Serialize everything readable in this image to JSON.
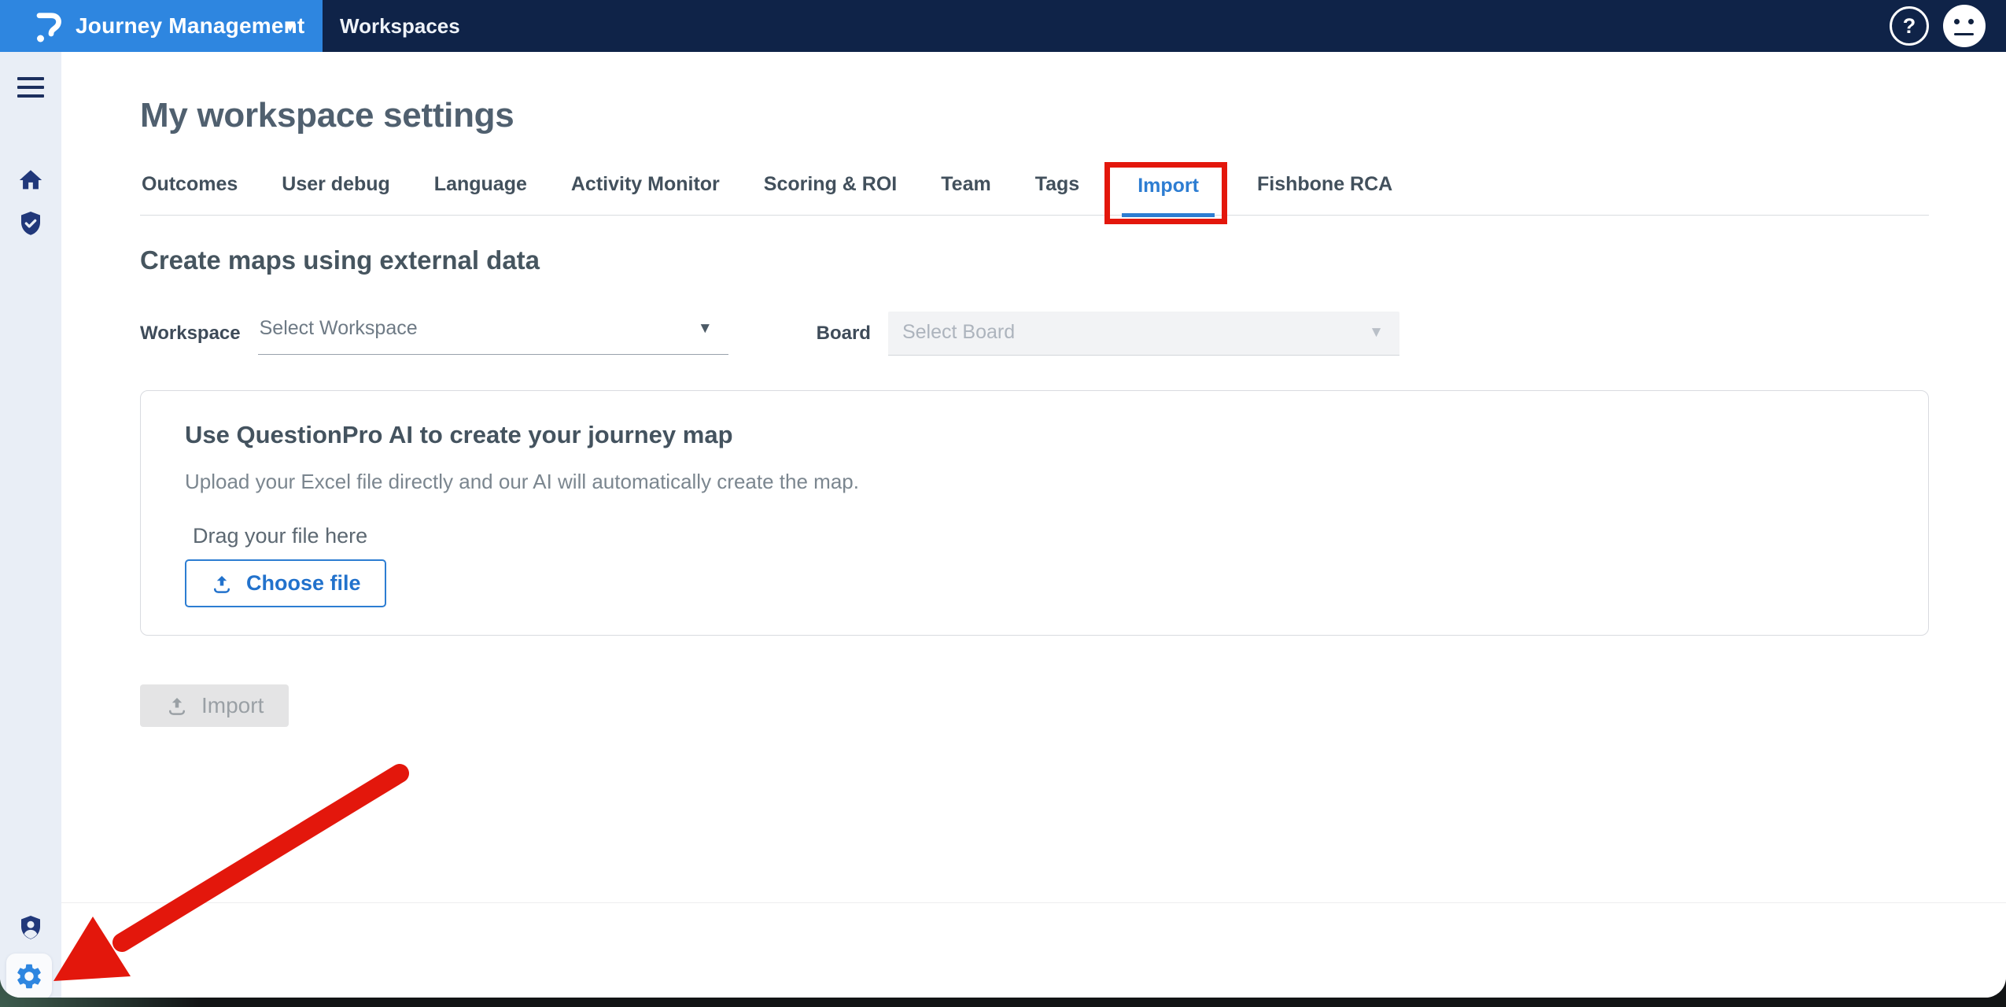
{
  "header": {
    "app_title": "Journey Management",
    "nav_item": "Workspaces"
  },
  "page": {
    "title": "My workspace settings"
  },
  "tabs": {
    "items": [
      {
        "label": "Outcomes",
        "active": false
      },
      {
        "label": "User debug",
        "active": false
      },
      {
        "label": "Language",
        "active": false
      },
      {
        "label": "Activity Monitor",
        "active": false
      },
      {
        "label": "Scoring & ROI",
        "active": false
      },
      {
        "label": "Team",
        "active": false
      },
      {
        "label": "Tags",
        "active": false
      },
      {
        "label": "Import",
        "active": true
      },
      {
        "label": "Fishbone RCA",
        "active": false
      }
    ]
  },
  "section": {
    "heading": "Create maps using external data"
  },
  "form": {
    "workspace_label": "Workspace",
    "workspace_placeholder": "Select Workspace",
    "board_label": "Board",
    "board_placeholder": "Select Board"
  },
  "card": {
    "title": "Use QuestionPro AI to create your journey map",
    "description": "Upload your Excel file directly and our AI will automatically create the map.",
    "dropzone_label": "Drag your file here",
    "choose_file_label": "Choose file"
  },
  "actions": {
    "import_label": "Import"
  },
  "header_icons": {
    "help_glyph": "?"
  },
  "annotations": {
    "highlight_box_color": "#e3170c",
    "arrow_color": "#e3170c",
    "arrow_target": "settings-gear"
  },
  "colors": {
    "brand_blue": "#2e86e0",
    "header_navy": "#0f2348",
    "active_tab_blue": "#2d7dd2",
    "sidebar_bg": "#e9eef6"
  }
}
